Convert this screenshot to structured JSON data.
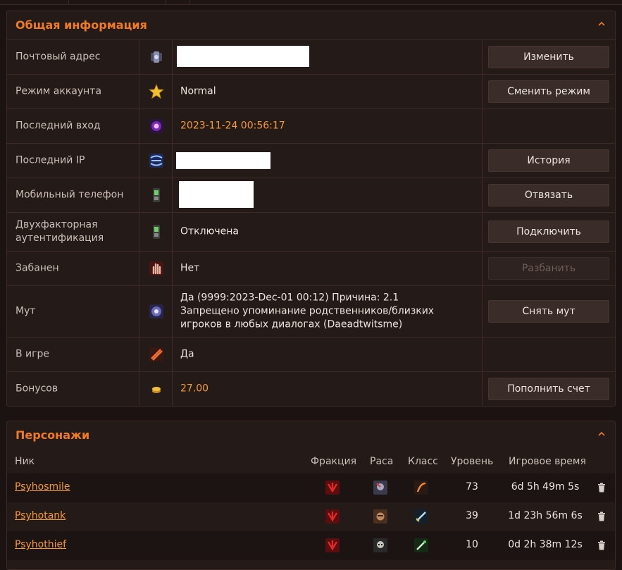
{
  "info": {
    "title": "Общая информация",
    "rows": [
      {
        "label": "Почтовый адрес",
        "icon": "email-icon",
        "value": "",
        "value_redacted": true,
        "button": "Изменить"
      },
      {
        "label": "Режим аккаунта",
        "icon": "star-icon",
        "value": "Normal",
        "button": "Сменить режим"
      },
      {
        "label": "Последний вход",
        "icon": "login-icon",
        "value": "2023-11-24 00:56:17",
        "value_orange": true,
        "button": ""
      },
      {
        "label": "Последний IP",
        "icon": "network-icon",
        "value": "",
        "value_redacted": true,
        "button": "История"
      },
      {
        "label": "Мобильный телефон",
        "icon": "phone-icon",
        "value": "",
        "value_redacted": true,
        "button": "Отвязать"
      },
      {
        "label": "Двухфакторная аутентификация",
        "icon": "phone-2fa-icon",
        "value": "Отключена",
        "button": "Подключить"
      },
      {
        "label": "Забанен",
        "icon": "ban-hand-icon",
        "value": "Нет",
        "button": "Разбанить",
        "button_disabled": true
      },
      {
        "label": "Мут",
        "icon": "mute-icon",
        "value": "Да (9999:2023-Dec-01 00:12) Причина: 2.1 Запрещено упоминание родственников/близких игроков в любых диалогах (Daeadtwitsme)",
        "button": "Снять мут"
      },
      {
        "label": "В игре",
        "icon": "ingame-icon",
        "value": "Да",
        "button": ""
      },
      {
        "label": "Бонусов",
        "icon": "coins-icon",
        "value": "27.00",
        "value_orange": true,
        "button": "Пополнить счет"
      }
    ]
  },
  "characters": {
    "title": "Персонажи",
    "headers": {
      "name": "Ник",
      "faction": "Фракция",
      "race": "Раса",
      "class": "Класс",
      "level": "Уровень",
      "playtime": "Игровое время"
    },
    "rows": [
      {
        "name": "Psyhosmile",
        "faction": "horde-icon",
        "race": "race-icon",
        "class": "class-icon",
        "level": "73",
        "playtime": "6d 5h 49m 5s"
      },
      {
        "name": "Psyhotank",
        "faction": "horde-icon",
        "race": "race-icon",
        "class": "class-icon",
        "level": "39",
        "playtime": "1d 23h 56m 6s"
      },
      {
        "name": "Psyhothief",
        "faction": "horde-icon",
        "race": "race-icon",
        "class": "class-icon",
        "level": "10",
        "playtime": "0d 2h 38m 12s"
      }
    ]
  },
  "colors": {
    "accent": "#f07b22",
    "value_orange": "#f59a2e",
    "background": "#1b1312",
    "panel": "#241a18"
  }
}
